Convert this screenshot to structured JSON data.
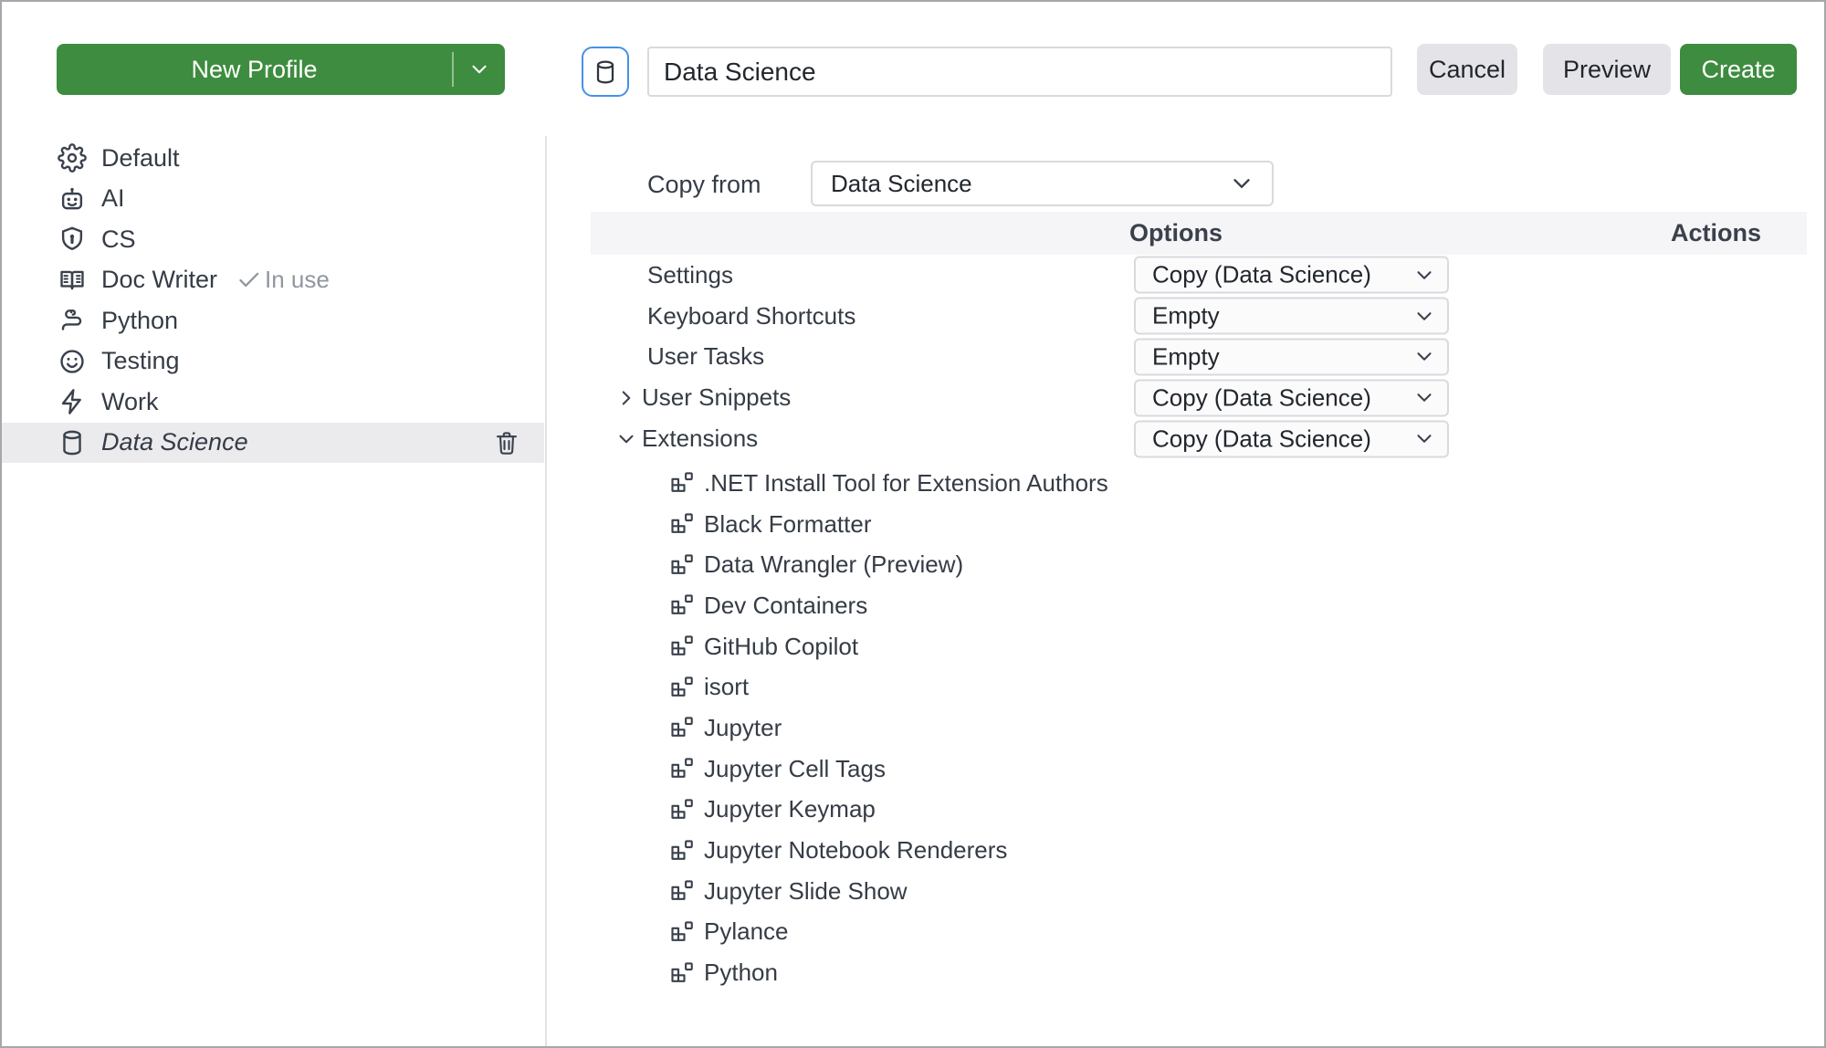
{
  "sidebar": {
    "new_profile_label": "New Profile",
    "profiles": [
      {
        "name": "Default"
      },
      {
        "name": "AI"
      },
      {
        "name": "CS"
      },
      {
        "name": "Doc Writer",
        "badge": "In use"
      },
      {
        "name": "Python"
      },
      {
        "name": "Testing"
      },
      {
        "name": "Work"
      },
      {
        "name": "Data Science",
        "selected": true
      }
    ]
  },
  "header": {
    "name_value": "Data Science",
    "cancel_label": "Cancel",
    "preview_label": "Preview",
    "create_label": "Create"
  },
  "copy_from": {
    "label": "Copy from",
    "value": "Data Science"
  },
  "table": {
    "columns": {
      "options": "Options",
      "actions": "Actions"
    },
    "rows": [
      {
        "label": "Settings",
        "option": "Copy (Data Science)"
      },
      {
        "label": "Keyboard Shortcuts",
        "option": "Empty"
      },
      {
        "label": "User Tasks",
        "option": "Empty"
      },
      {
        "label": "User Snippets",
        "option": "Copy (Data Science)",
        "expanded": false
      },
      {
        "label": "Extensions",
        "option": "Copy (Data Science)",
        "expanded": true
      }
    ],
    "extensions": [
      ".NET Install Tool for Extension Authors",
      "Black Formatter",
      "Data Wrangler (Preview)",
      "Dev Containers",
      "GitHub Copilot",
      "isort",
      "Jupyter",
      "Jupyter Cell Tags",
      "Jupyter Keymap",
      "Jupyter Notebook Renderers",
      "Jupyter Slide Show",
      "Pylance",
      "Python"
    ]
  },
  "colors": {
    "accent_green": "#3e8c3f",
    "focus_blue": "#4592e6",
    "selected_row_bg": "#ebebee",
    "header_band_bg": "#f5f5f7",
    "text": "#353c46",
    "muted_text": "#9096a0"
  }
}
